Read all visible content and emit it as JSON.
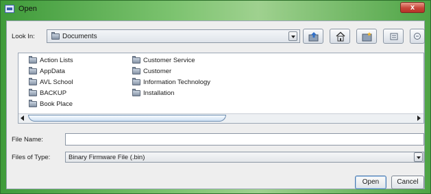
{
  "window": {
    "title": "Open",
    "close_label": "x"
  },
  "look_in": {
    "label": "Look In:",
    "value": "Documents"
  },
  "toolbar": [
    {
      "name": "up-one-level-button",
      "icon": "up-folder-icon"
    },
    {
      "name": "home-button",
      "icon": "home-icon"
    },
    {
      "name": "new-folder-button",
      "icon": "new-folder-icon"
    },
    {
      "name": "list-view-button",
      "icon": "list-view-icon"
    },
    {
      "name": "details-view-button",
      "icon": "details-view-icon"
    }
  ],
  "files": {
    "column1": [
      "Action Lists",
      "AppData",
      "AVL School",
      "BACKUP",
      "Book Place"
    ],
    "column2": [
      "Customer Service",
      "Customer",
      "Information Technology",
      "Installation"
    ]
  },
  "file_name": {
    "label": "File Name:",
    "value": ""
  },
  "file_type": {
    "label": "Files of Type:",
    "value": "Binary Firmware File (.bin)"
  },
  "buttons": {
    "open": "Open",
    "cancel": "Cancel"
  },
  "colors": {
    "title_bar": "#7cc36f",
    "close_button": "#c8463a",
    "dialog_bg": "#eeeeee",
    "focus_border": "#4a79ad"
  }
}
